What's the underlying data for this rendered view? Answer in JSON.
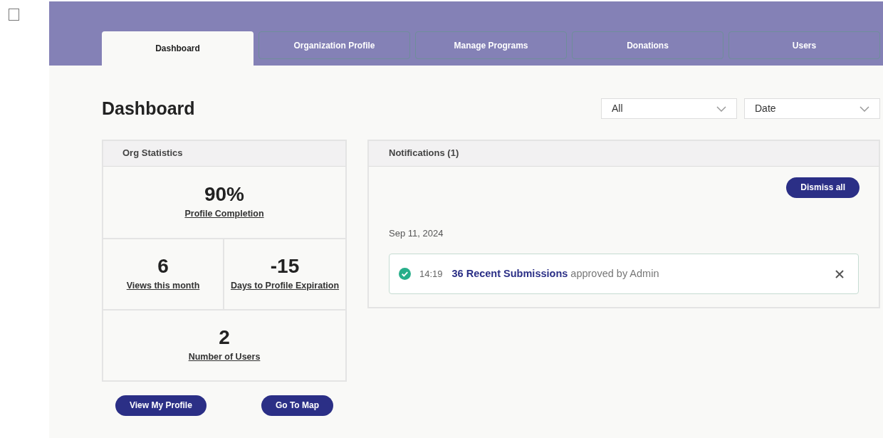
{
  "checkbox": {
    "checked": false
  },
  "tabs": [
    {
      "label": "Dashboard",
      "selected": true
    },
    {
      "label": "Organization Profile",
      "selected": false
    },
    {
      "label": "Manage Programs",
      "selected": false
    },
    {
      "label": "Donations",
      "selected": false
    },
    {
      "label": "Users",
      "selected": false
    }
  ],
  "title": "Dashboard",
  "filters": [
    {
      "value": "All"
    },
    {
      "value": "Date"
    }
  ],
  "org_statistics": {
    "title": "Org Statistics",
    "stats": [
      {
        "value": "90%",
        "label": "Profile Completion",
        "kind": "wide"
      },
      {
        "value": "6",
        "label": "Views this month",
        "kind": "narrow"
      },
      {
        "value": "-15",
        "label": "Days to Profile Expiration",
        "kind": "narrow"
      },
      {
        "value": "2",
        "label": "Number of Users",
        "kind": "wide"
      }
    ]
  },
  "actions": [
    "View My Profile",
    "Go To Map"
  ],
  "notifications": {
    "title": "Notifications (1)",
    "dismiss_all": "Dismiss all",
    "groups": [
      {
        "date": "Sep 11, 2024",
        "items": [
          {
            "kind": "success",
            "time": "14:19",
            "link": "36 Recent Submissions",
            "text": "approved by Admin"
          }
        ]
      }
    ]
  }
}
